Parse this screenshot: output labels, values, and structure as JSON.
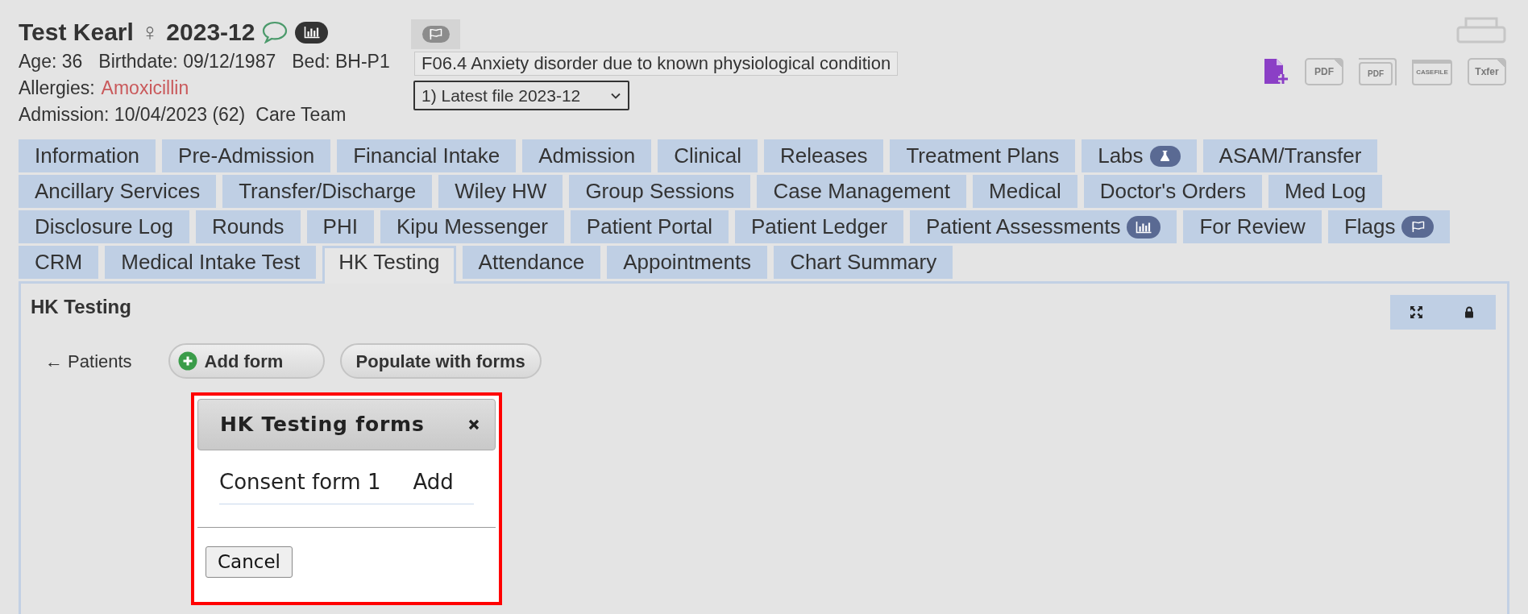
{
  "header": {
    "name": "Test Kearl",
    "sex_symbol": "♀",
    "file_id": "2023-12",
    "details": [
      "Age: 36",
      "Birthdate: 09/12/1987",
      "Bed: BH-P1"
    ],
    "allergies": {
      "label": "Allergies:",
      "value": "Amoxicillin"
    },
    "admission": "Admission: 10/04/2023 (62)",
    "care_team": "Care Team"
  },
  "diagnosis": "F06.4 Anxiety disorder due to known physiological condition",
  "file_select": {
    "value": "1) Latest file 2023-12"
  },
  "toolbar": [
    {
      "kind": "new",
      "disabled": false
    },
    {
      "kind": "doc",
      "label": "PDF",
      "disabled": true
    },
    {
      "kind": "stack",
      "label": "PDF",
      "disabled": true
    },
    {
      "kind": "folder",
      "label": "CASEFILE",
      "disabled": true
    },
    {
      "kind": "doc",
      "label": "Txfer",
      "disabled": true
    }
  ],
  "tab_rows": [
    {
      "tabs": [
        {
          "label": "Information",
          "selected": false,
          "kind": "plain"
        },
        {
          "label": "Pre-Admission",
          "selected": false,
          "kind": "plain"
        },
        {
          "label": "Financial Intake",
          "selected": false,
          "kind": "plain"
        },
        {
          "label": "Admission",
          "selected": false,
          "kind": "plain"
        },
        {
          "label": "Clinical",
          "selected": false,
          "kind": "plain"
        },
        {
          "label": "Releases",
          "selected": false,
          "kind": "plain"
        },
        {
          "label": "Treatment Plans",
          "selected": false,
          "kind": "plain"
        },
        {
          "label": "Labs",
          "selected": false,
          "kind": "flask"
        },
        {
          "label": "ASAM/Transfer",
          "selected": false,
          "kind": "plain"
        }
      ]
    },
    {
      "tabs": [
        {
          "label": "Ancillary Services",
          "selected": false,
          "kind": "plain"
        },
        {
          "label": "Transfer/Discharge",
          "selected": false,
          "kind": "plain"
        },
        {
          "label": "Wiley HW",
          "selected": false,
          "kind": "plain"
        },
        {
          "label": "Group Sessions",
          "selected": false,
          "kind": "plain"
        },
        {
          "label": "Case Management",
          "selected": false,
          "kind": "plain"
        },
        {
          "label": "Medical",
          "selected": false,
          "kind": "plain"
        },
        {
          "label": "Doctor's Orders",
          "selected": false,
          "kind": "plain"
        },
        {
          "label": "Med Log",
          "selected": false,
          "kind": "plain"
        }
      ]
    },
    {
      "tabs": [
        {
          "label": "Disclosure Log",
          "selected": false,
          "kind": "plain"
        },
        {
          "label": "Rounds",
          "selected": false,
          "kind": "plain"
        },
        {
          "label": "PHI",
          "selected": false,
          "kind": "plain"
        },
        {
          "label": "Kipu Messenger",
          "selected": false,
          "kind": "plain"
        },
        {
          "label": "Patient Portal",
          "selected": false,
          "kind": "plain"
        },
        {
          "label": "Patient Ledger",
          "selected": false,
          "kind": "plain"
        },
        {
          "label": "Patient Assessments",
          "selected": false,
          "kind": "chart"
        },
        {
          "label": "For Review",
          "selected": false,
          "kind": "plain"
        },
        {
          "label": "Flags",
          "selected": false,
          "kind": "flag"
        }
      ]
    },
    {
      "tabs": [
        {
          "label": "CRM",
          "selected": false,
          "kind": "plain"
        },
        {
          "label": "Medical Intake Test",
          "selected": false,
          "kind": "plain"
        },
        {
          "label": "HK Testing",
          "selected": true,
          "kind": "plain"
        },
        {
          "label": "Attendance",
          "selected": false,
          "kind": "plain"
        },
        {
          "label": "Appointments",
          "selected": false,
          "kind": "plain"
        },
        {
          "label": "Chart Summary",
          "selected": false,
          "kind": "plain"
        }
      ]
    }
  ],
  "panel": {
    "title": "HK Testing",
    "back_link": "← Patients",
    "buttons": [
      {
        "label": "Add form",
        "kind": "add"
      },
      {
        "label": "Populate with forms",
        "kind": "plain"
      }
    ]
  },
  "dialog": {
    "title": "HK Testing forms",
    "highlighted": true,
    "forms": [
      {
        "name": "Consent form 1",
        "action": "Add"
      }
    ],
    "cancel": "Cancel"
  }
}
